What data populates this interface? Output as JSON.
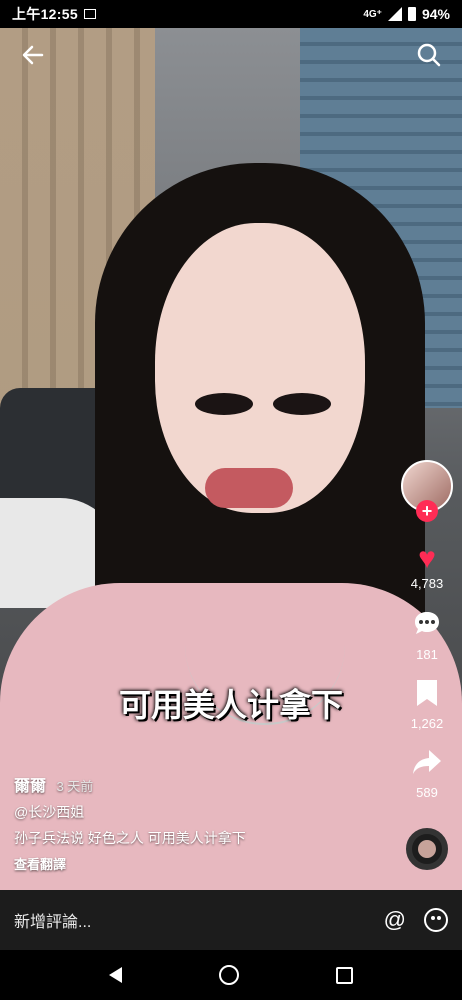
{
  "status_bar": {
    "time": "上午12:55",
    "network": "4G⁺",
    "battery": "94%"
  },
  "overlay": {
    "back_icon": "back-arrow-icon",
    "search_icon": "search-icon"
  },
  "subtitle": "可用美人计拿下",
  "actions": {
    "likes": "4,783",
    "comments": "181",
    "saves": "1,262",
    "shares": "589",
    "like_color": "#ff2c55"
  },
  "caption": {
    "author": "爾爾",
    "time": "3 天前",
    "location": "@长沙西姐",
    "text": "孙子兵法说 好色之人 可用美人计拿下",
    "translate": "查看翻譯"
  },
  "comment_bar": {
    "placeholder": "新增評論..."
  }
}
